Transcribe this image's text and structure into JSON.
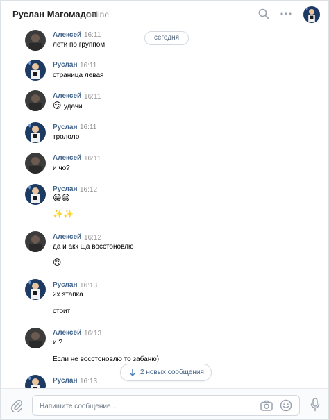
{
  "header": {
    "name": "Руслан Магомадов",
    "status": "online"
  },
  "date_pill": "сегодня",
  "messages": [
    {
      "author": "Алексей",
      "time": "16:11",
      "lines": [
        "лети по группом"
      ],
      "avatar": "aleksey"
    },
    {
      "author": "Руслан",
      "time": "16:11",
      "lines": [
        "страница левая"
      ],
      "avatar": "ruslan"
    },
    {
      "author": "Алексей",
      "time": "16:11",
      "lines": [
        "удачи"
      ],
      "emoji_prefix": "😏",
      "avatar": "aleksey"
    },
    {
      "author": "Руслан",
      "time": "16:11",
      "lines": [
        "трололо"
      ],
      "avatar": "ruslan"
    },
    {
      "author": "Алексей",
      "time": "16:11",
      "lines": [
        "и чо?"
      ],
      "avatar": "aleksey"
    },
    {
      "author": "Руслан",
      "time": "16:12",
      "lines": [
        "😁😄",
        "✨✨"
      ],
      "avatar": "ruslan"
    },
    {
      "author": "Алексей",
      "time": "16:12",
      "lines": [
        "да и акк ща восстоновлю",
        "😌"
      ],
      "avatar": "aleksey"
    },
    {
      "author": "Руслан",
      "time": "16:13",
      "lines": [
        "2х этапка",
        "стоит"
      ],
      "avatar": "ruslan"
    },
    {
      "author": "Алексей",
      "time": "16:13",
      "lines": [
        "и ?",
        "Если не восстоновлю то забаню)"
      ],
      "avatar": "aleksey"
    },
    {
      "author": "Руслан",
      "time": "16:13",
      "lines": [],
      "avatar": "ruslan"
    }
  ],
  "new_messages_label": "2 новых сообщения",
  "composer": {
    "placeholder": "Напишите сообщение..."
  },
  "icons": {
    "search": "search-icon",
    "more": "more-icon",
    "attach": "paperclip-icon",
    "camera": "camera-icon",
    "emoji": "smile-icon",
    "voice": "microphone-icon",
    "scroll_down": "arrow-down-icon"
  },
  "colors": {
    "author": "#42648b",
    "time": "#939393",
    "pill_border": "#d3d9de"
  }
}
